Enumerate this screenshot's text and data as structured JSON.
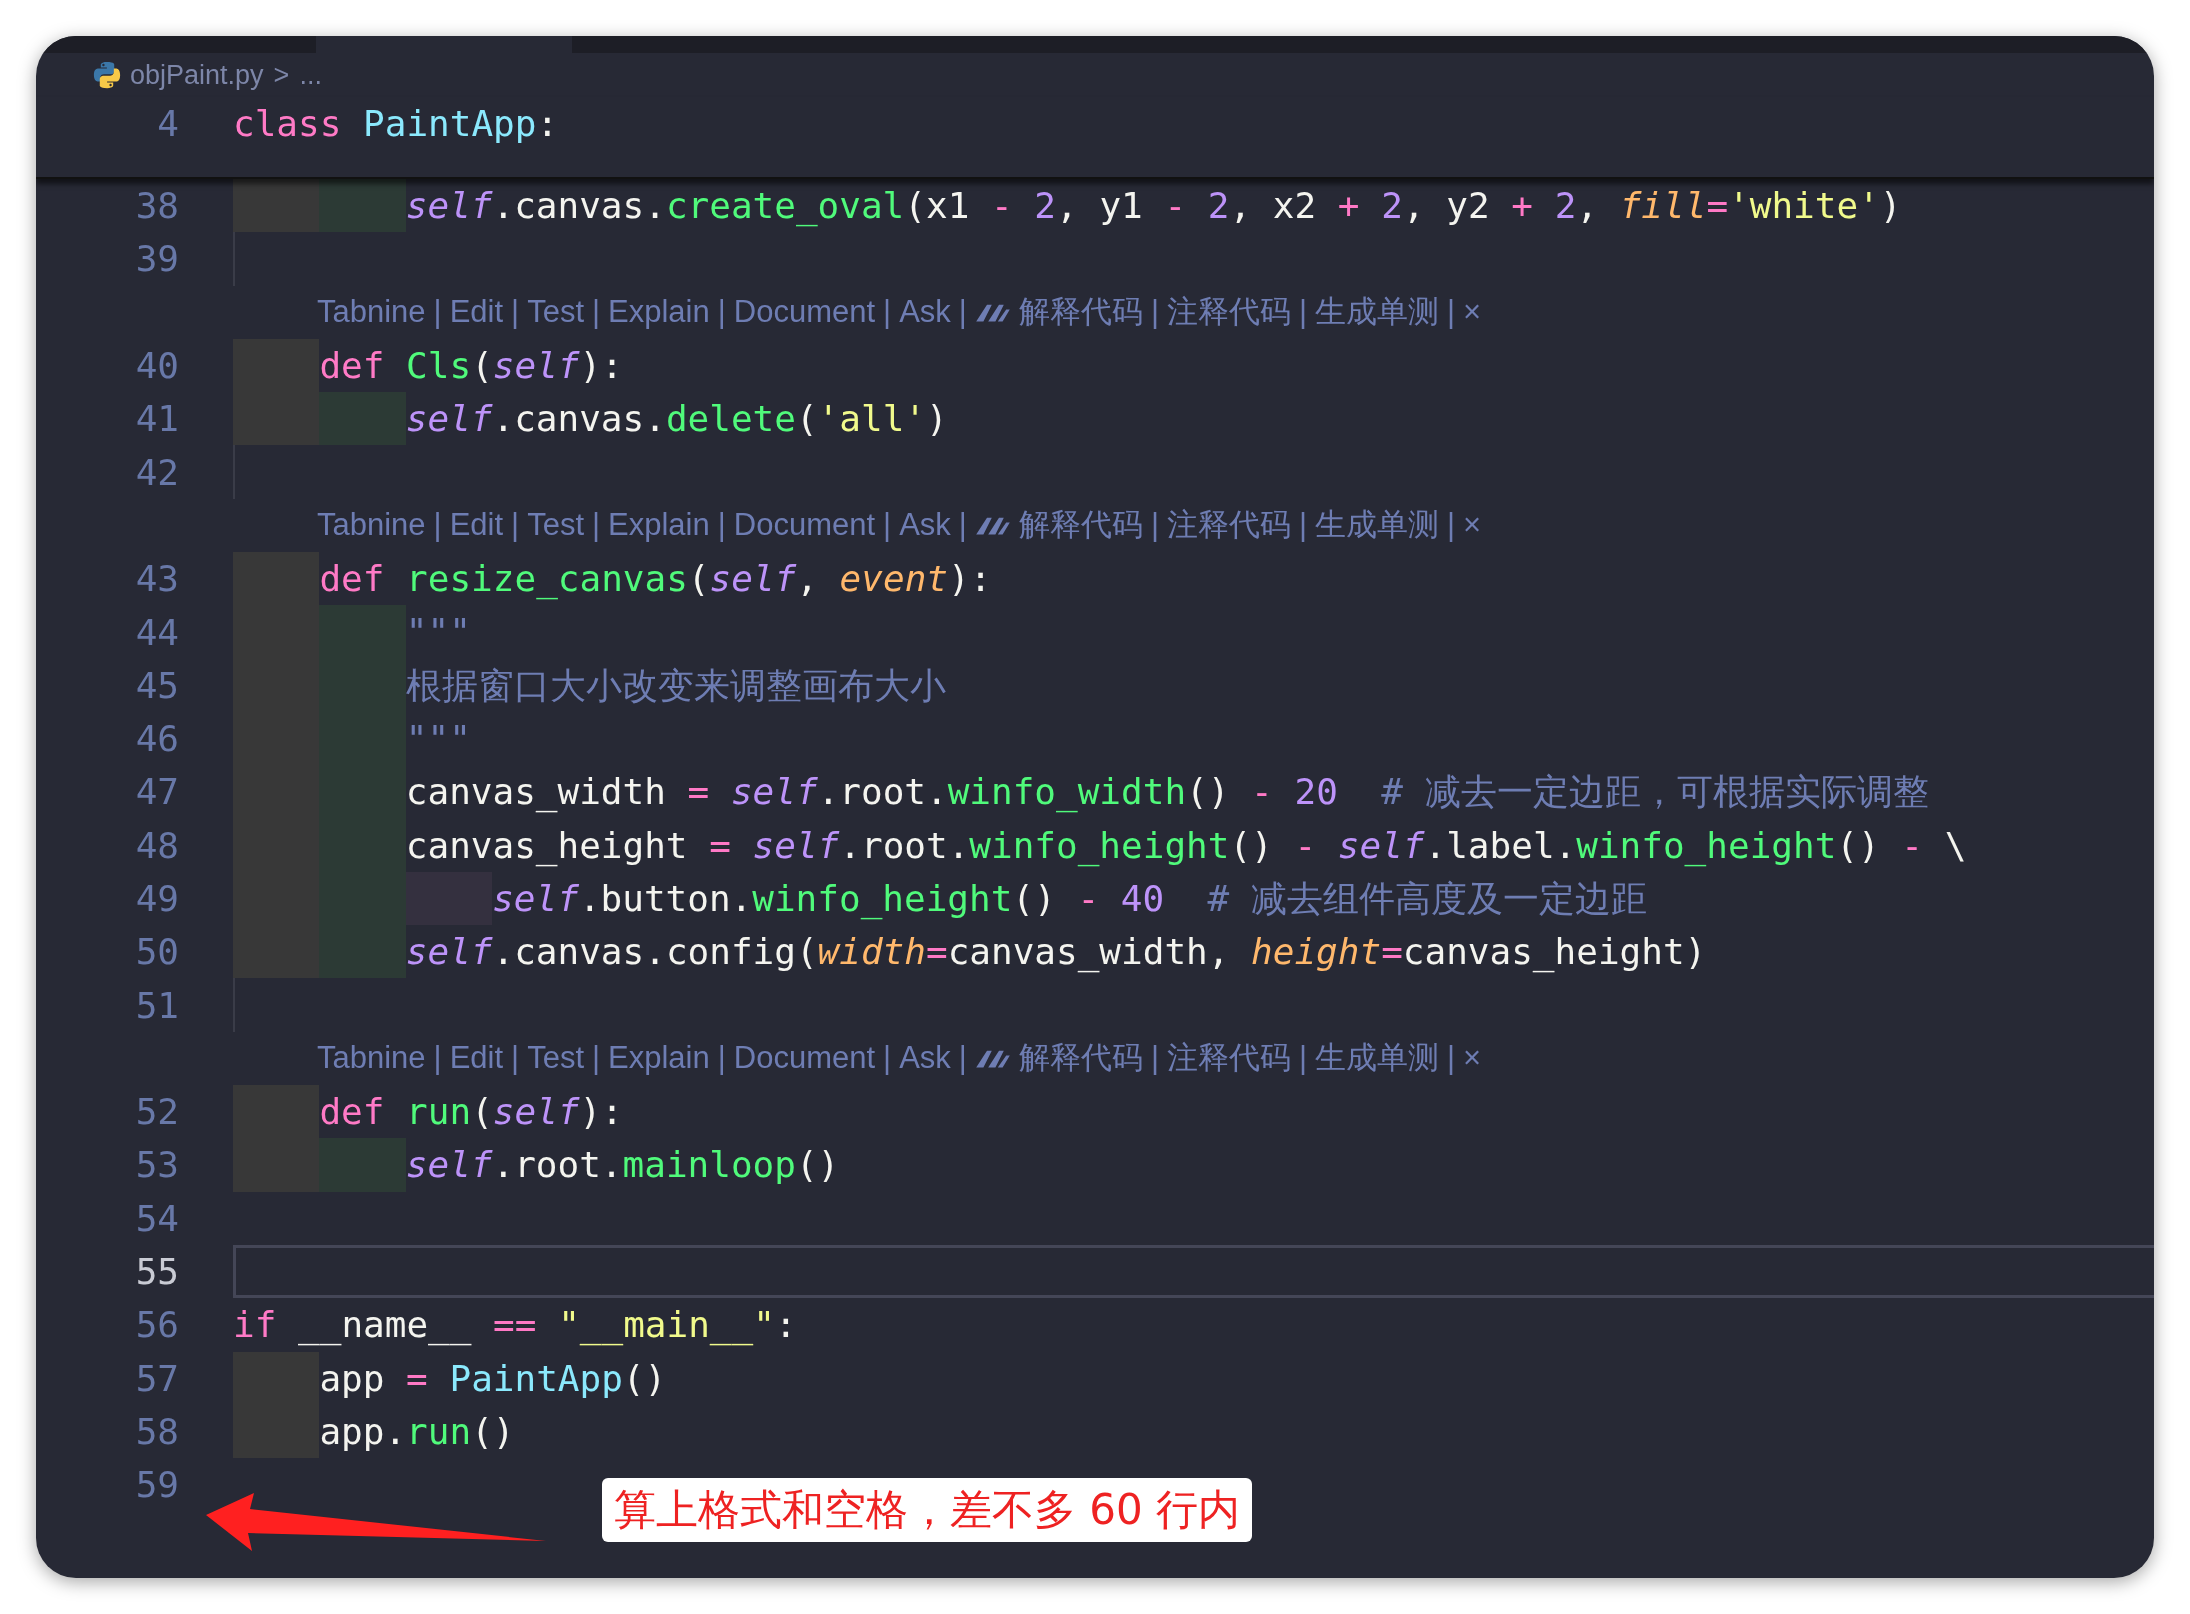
{
  "breadcrumb": {
    "file": "objPaint.py",
    "separator": ">",
    "rest": "..."
  },
  "sticky": {
    "number": "4",
    "tokens": [
      {
        "kind": "kw",
        "text": "class"
      },
      {
        "kind": "cls",
        "text": " PaintApp"
      },
      {
        "kind": "txt",
        "text": ":"
      }
    ]
  },
  "rows": [
    {
      "kind": "code",
      "number": "38",
      "current": false,
      "tokens": [
        {
          "kind": "indent",
          "color": "#383838"
        },
        {
          "kind": "indent",
          "color": "#2c3a35"
        },
        {
          "kind": "self",
          "text": "self"
        },
        {
          "kind": "txt",
          "text": ".canvas."
        },
        {
          "kind": "fn",
          "text": "create_oval"
        },
        {
          "kind": "txt",
          "text": "(x1 "
        },
        {
          "kind": "op",
          "text": "-"
        },
        {
          "kind": "num",
          "text": " 2"
        },
        {
          "kind": "txt",
          "text": ", y1 "
        },
        {
          "kind": "op",
          "text": "-"
        },
        {
          "kind": "num",
          "text": " 2"
        },
        {
          "kind": "txt",
          "text": ", x2 "
        },
        {
          "kind": "op",
          "text": "+"
        },
        {
          "kind": "num",
          "text": " 2"
        },
        {
          "kind": "txt",
          "text": ", y2 "
        },
        {
          "kind": "op",
          "text": "+"
        },
        {
          "kind": "num",
          "text": " 2"
        },
        {
          "kind": "txt",
          "text": ", "
        },
        {
          "kind": "param",
          "text": "fill"
        },
        {
          "kind": "op",
          "text": "="
        },
        {
          "kind": "str",
          "text": "'white'"
        },
        {
          "kind": "txt",
          "text": ")"
        }
      ]
    },
    {
      "kind": "code",
      "number": "39",
      "current": false,
      "tokens": [
        {
          "kind": "guide"
        }
      ]
    },
    {
      "kind": "lens",
      "items": [
        {
          "kind": "link",
          "text": "Tabnine"
        },
        {
          "kind": "sep",
          "text": "|"
        },
        {
          "kind": "link",
          "text": "Edit"
        },
        {
          "kind": "sep",
          "text": "|"
        },
        {
          "kind": "link",
          "text": "Test"
        },
        {
          "kind": "sep",
          "text": "|"
        },
        {
          "kind": "link",
          "text": "Explain"
        },
        {
          "kind": "sep",
          "text": "|"
        },
        {
          "kind": "link",
          "text": "Document"
        },
        {
          "kind": "sep",
          "text": "|"
        },
        {
          "kind": "link",
          "text": "Ask"
        },
        {
          "kind": "sep",
          "text": "|"
        },
        {
          "kind": "icon"
        },
        {
          "kind": "link",
          "text": "解释代码"
        },
        {
          "kind": "sep",
          "text": "|"
        },
        {
          "kind": "link",
          "text": "注释代码"
        },
        {
          "kind": "sep",
          "text": "|"
        },
        {
          "kind": "link",
          "text": "生成单测"
        },
        {
          "kind": "sep",
          "text": "|"
        },
        {
          "kind": "close",
          "text": "×"
        }
      ]
    },
    {
      "kind": "code",
      "number": "40",
      "current": false,
      "tokens": [
        {
          "kind": "indent",
          "color": "#383838"
        },
        {
          "kind": "kw",
          "text": "def"
        },
        {
          "kind": "fn",
          "text": " Cls"
        },
        {
          "kind": "txt",
          "text": "("
        },
        {
          "kind": "self",
          "text": "self"
        },
        {
          "kind": "txt",
          "text": "):"
        }
      ]
    },
    {
      "kind": "code",
      "number": "41",
      "current": false,
      "tokens": [
        {
          "kind": "indent",
          "color": "#383838"
        },
        {
          "kind": "indent",
          "color": "#2c3a35"
        },
        {
          "kind": "self",
          "text": "self"
        },
        {
          "kind": "txt",
          "text": ".canvas."
        },
        {
          "kind": "fn",
          "text": "delete"
        },
        {
          "kind": "txt",
          "text": "("
        },
        {
          "kind": "str",
          "text": "'all'"
        },
        {
          "kind": "txt",
          "text": ")"
        }
      ]
    },
    {
      "kind": "code",
      "number": "42",
      "current": false,
      "tokens": [
        {
          "kind": "guide"
        }
      ]
    },
    {
      "kind": "lens",
      "items": [
        {
          "kind": "link",
          "text": "Tabnine"
        },
        {
          "kind": "sep",
          "text": "|"
        },
        {
          "kind": "link",
          "text": "Edit"
        },
        {
          "kind": "sep",
          "text": "|"
        },
        {
          "kind": "link",
          "text": "Test"
        },
        {
          "kind": "sep",
          "text": "|"
        },
        {
          "kind": "link",
          "text": "Explain"
        },
        {
          "kind": "sep",
          "text": "|"
        },
        {
          "kind": "link",
          "text": "Document"
        },
        {
          "kind": "sep",
          "text": "|"
        },
        {
          "kind": "link",
          "text": "Ask"
        },
        {
          "kind": "sep",
          "text": "|"
        },
        {
          "kind": "icon"
        },
        {
          "kind": "link",
          "text": "解释代码"
        },
        {
          "kind": "sep",
          "text": "|"
        },
        {
          "kind": "link",
          "text": "注释代码"
        },
        {
          "kind": "sep",
          "text": "|"
        },
        {
          "kind": "link",
          "text": "生成单测"
        },
        {
          "kind": "sep",
          "text": "|"
        },
        {
          "kind": "close",
          "text": "×"
        }
      ]
    },
    {
      "kind": "code",
      "number": "43",
      "current": false,
      "tokens": [
        {
          "kind": "indent",
          "color": "#383838"
        },
        {
          "kind": "kw",
          "text": "def"
        },
        {
          "kind": "fn",
          "text": " resize_canvas"
        },
        {
          "kind": "txt",
          "text": "("
        },
        {
          "kind": "self",
          "text": "self"
        },
        {
          "kind": "txt",
          "text": ", "
        },
        {
          "kind": "param",
          "text": "event"
        },
        {
          "kind": "txt",
          "text": "):"
        }
      ]
    },
    {
      "kind": "code",
      "number": "44",
      "current": false,
      "tokens": [
        {
          "kind": "indent",
          "color": "#383838"
        },
        {
          "kind": "indent",
          "color": "#2c3a35"
        },
        {
          "kind": "cmt",
          "text": "\"\"\""
        }
      ]
    },
    {
      "kind": "code",
      "number": "45",
      "current": false,
      "tokens": [
        {
          "kind": "indent",
          "color": "#383838"
        },
        {
          "kind": "indent",
          "color": "#2c3a35"
        },
        {
          "kind": "cmt",
          "text": "根据窗口大小改变来调整画布大小"
        }
      ]
    },
    {
      "kind": "code",
      "number": "46",
      "current": false,
      "tokens": [
        {
          "kind": "indent",
          "color": "#383838"
        },
        {
          "kind": "indent",
          "color": "#2c3a35"
        },
        {
          "kind": "cmt",
          "text": "\"\"\""
        }
      ]
    },
    {
      "kind": "code",
      "number": "47",
      "current": false,
      "tokens": [
        {
          "kind": "indent",
          "color": "#383838"
        },
        {
          "kind": "indent",
          "color": "#2c3a35"
        },
        {
          "kind": "txt",
          "text": "canvas_width "
        },
        {
          "kind": "op",
          "text": "="
        },
        {
          "kind": "self",
          "text": " self"
        },
        {
          "kind": "txt",
          "text": ".root."
        },
        {
          "kind": "fn",
          "text": "winfo_width"
        },
        {
          "kind": "txt",
          "text": "() "
        },
        {
          "kind": "op",
          "text": "-"
        },
        {
          "kind": "num",
          "text": " 20"
        },
        {
          "kind": "cmt",
          "text": "  # 减去一定边距，可根据实际调整"
        }
      ]
    },
    {
      "kind": "code",
      "number": "48",
      "current": false,
      "tokens": [
        {
          "kind": "indent",
          "color": "#383838"
        },
        {
          "kind": "indent",
          "color": "#2c3a35"
        },
        {
          "kind": "txt",
          "text": "canvas_height "
        },
        {
          "kind": "op",
          "text": "="
        },
        {
          "kind": "self",
          "text": " self"
        },
        {
          "kind": "txt",
          "text": ".root."
        },
        {
          "kind": "fn",
          "text": "winfo_height"
        },
        {
          "kind": "txt",
          "text": "() "
        },
        {
          "kind": "op",
          "text": "-"
        },
        {
          "kind": "self",
          "text": " self"
        },
        {
          "kind": "txt",
          "text": ".label."
        },
        {
          "kind": "fn",
          "text": "winfo_height"
        },
        {
          "kind": "txt",
          "text": "() "
        },
        {
          "kind": "op",
          "text": "-"
        },
        {
          "kind": "txt",
          "text": " \\"
        }
      ]
    },
    {
      "kind": "code",
      "number": "49",
      "current": false,
      "tokens": [
        {
          "kind": "indent",
          "color": "#383838"
        },
        {
          "kind": "indent",
          "color": "#2c3a35"
        },
        {
          "kind": "indent",
          "color": "#34303f"
        },
        {
          "kind": "self",
          "text": "self"
        },
        {
          "kind": "txt",
          "text": ".button."
        },
        {
          "kind": "fn",
          "text": "winfo_height"
        },
        {
          "kind": "txt",
          "text": "() "
        },
        {
          "kind": "op",
          "text": "-"
        },
        {
          "kind": "num",
          "text": " 40"
        },
        {
          "kind": "cmt",
          "text": "  # 减去组件高度及一定边距"
        }
      ]
    },
    {
      "kind": "code",
      "number": "50",
      "current": false,
      "tokens": [
        {
          "kind": "indent",
          "color": "#383838"
        },
        {
          "kind": "indent",
          "color": "#2c3a35"
        },
        {
          "kind": "self",
          "text": "self"
        },
        {
          "kind": "txt",
          "text": ".canvas.config("
        },
        {
          "kind": "param",
          "text": "width"
        },
        {
          "kind": "op",
          "text": "="
        },
        {
          "kind": "txt",
          "text": "canvas_width, "
        },
        {
          "kind": "param",
          "text": "height"
        },
        {
          "kind": "op",
          "text": "="
        },
        {
          "kind": "txt",
          "text": "canvas_height)"
        }
      ]
    },
    {
      "kind": "code",
      "number": "51",
      "current": false,
      "tokens": [
        {
          "kind": "guide"
        }
      ]
    },
    {
      "kind": "lens",
      "items": [
        {
          "kind": "link",
          "text": "Tabnine"
        },
        {
          "kind": "sep",
          "text": "|"
        },
        {
          "kind": "link",
          "text": "Edit"
        },
        {
          "kind": "sep",
          "text": "|"
        },
        {
          "kind": "link",
          "text": "Test"
        },
        {
          "kind": "sep",
          "text": "|"
        },
        {
          "kind": "link",
          "text": "Explain"
        },
        {
          "kind": "sep",
          "text": "|"
        },
        {
          "kind": "link",
          "text": "Document"
        },
        {
          "kind": "sep",
          "text": "|"
        },
        {
          "kind": "link",
          "text": "Ask"
        },
        {
          "kind": "sep",
          "text": "|"
        },
        {
          "kind": "icon"
        },
        {
          "kind": "link",
          "text": "解释代码"
        },
        {
          "kind": "sep",
          "text": "|"
        },
        {
          "kind": "link",
          "text": "注释代码"
        },
        {
          "kind": "sep",
          "text": "|"
        },
        {
          "kind": "link",
          "text": "生成单测"
        },
        {
          "kind": "sep",
          "text": "|"
        },
        {
          "kind": "close",
          "text": "×"
        }
      ]
    },
    {
      "kind": "code",
      "number": "52",
      "current": false,
      "tokens": [
        {
          "kind": "indent",
          "color": "#383838"
        },
        {
          "kind": "kw",
          "text": "def"
        },
        {
          "kind": "fn",
          "text": " run"
        },
        {
          "kind": "txt",
          "text": "("
        },
        {
          "kind": "self",
          "text": "self"
        },
        {
          "kind": "txt",
          "text": "):"
        }
      ]
    },
    {
      "kind": "code",
      "number": "53",
      "current": false,
      "tokens": [
        {
          "kind": "indent",
          "color": "#383838"
        },
        {
          "kind": "indent",
          "color": "#2c3a35"
        },
        {
          "kind": "self",
          "text": "self"
        },
        {
          "kind": "txt",
          "text": ".root."
        },
        {
          "kind": "fn",
          "text": "mainloop"
        },
        {
          "kind": "txt",
          "text": "()"
        }
      ]
    },
    {
      "kind": "code",
      "number": "54",
      "current": false,
      "tokens": []
    },
    {
      "kind": "code",
      "number": "55",
      "current": true,
      "tokens": []
    },
    {
      "kind": "code",
      "number": "56",
      "current": false,
      "tokens": [
        {
          "kind": "kw",
          "text": "if"
        },
        {
          "kind": "txt",
          "text": " __name__ "
        },
        {
          "kind": "op",
          "text": "=="
        },
        {
          "kind": "str",
          "text": " \"__main__\""
        },
        {
          "kind": "txt",
          "text": ":"
        }
      ]
    },
    {
      "kind": "code",
      "number": "57",
      "current": false,
      "tokens": [
        {
          "kind": "indent",
          "color": "#383838"
        },
        {
          "kind": "txt",
          "text": "app "
        },
        {
          "kind": "op",
          "text": "="
        },
        {
          "kind": "cls",
          "text": " PaintApp"
        },
        {
          "kind": "txt",
          "text": "()"
        }
      ]
    },
    {
      "kind": "code",
      "number": "58",
      "current": false,
      "tokens": [
        {
          "kind": "indent",
          "color": "#383838"
        },
        {
          "kind": "txt",
          "text": "app."
        },
        {
          "kind": "fn",
          "text": "run"
        },
        {
          "kind": "txt",
          "text": "()"
        }
      ]
    },
    {
      "kind": "code",
      "number": "59",
      "current": false,
      "tokens": []
    }
  ],
  "annotation": {
    "text": "算上格式和空格，差不多 60 行内"
  }
}
